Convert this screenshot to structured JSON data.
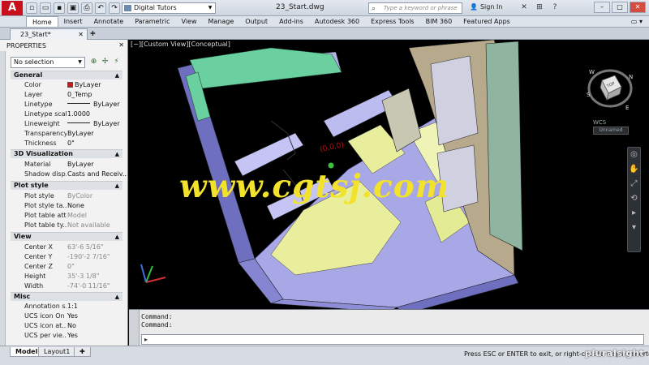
{
  "titlebar": {
    "logo": "A",
    "workspace": "Digital Tutors",
    "doc_title": "23_Start.dwg",
    "search_placeholder": "Type a keyword or phrase",
    "signin": "Sign In"
  },
  "ribbon": {
    "tabs": [
      "Home",
      "Insert",
      "Annotate",
      "Parametric",
      "View",
      "Manage",
      "Output",
      "Add-ins",
      "Autodesk 360",
      "Express Tools",
      "BIM 360",
      "Featured Apps"
    ],
    "active": "Home"
  },
  "file_tab": {
    "label": "23_Start*"
  },
  "properties": {
    "title": "PROPERTIES",
    "selection": "No selection",
    "sections": {
      "general": {
        "title": "General",
        "rows": [
          {
            "k": "Color",
            "v": "ByLayer"
          },
          {
            "k": "Layer",
            "v": "0_Temp"
          },
          {
            "k": "Linetype",
            "v": "ByLayer"
          },
          {
            "k": "Linetype scale",
            "v": "1.0000"
          },
          {
            "k": "Lineweight",
            "v": "ByLayer"
          },
          {
            "k": "Transparency",
            "v": "ByLayer"
          },
          {
            "k": "Thickness",
            "v": "0\""
          }
        ]
      },
      "viz": {
        "title": "3D Visualization",
        "rows": [
          {
            "k": "Material",
            "v": "ByLayer"
          },
          {
            "k": "Shadow disp...",
            "v": "Casts and Receiv..."
          }
        ]
      },
      "plot": {
        "title": "Plot style",
        "rows": [
          {
            "k": "Plot style",
            "v": "ByColor"
          },
          {
            "k": "Plot style ta...",
            "v": "None"
          },
          {
            "k": "Plot table att...",
            "v": "Model"
          },
          {
            "k": "Plot table ty...",
            "v": "Not available"
          }
        ]
      },
      "view": {
        "title": "View",
        "rows": [
          {
            "k": "Center X",
            "v": "63'-6 5/16\""
          },
          {
            "k": "Center Y",
            "v": "-190'-2 7/16\""
          },
          {
            "k": "Center Z",
            "v": "0\""
          },
          {
            "k": "Height",
            "v": "35'-3 1/8\""
          },
          {
            "k": "Width",
            "v": "-74'-0 11/16\""
          }
        ]
      },
      "misc": {
        "title": "Misc",
        "rows": [
          {
            "k": "Annotation s...",
            "v": "1:1"
          },
          {
            "k": "UCS icon On",
            "v": "Yes"
          },
          {
            "k": "UCS icon at...",
            "v": "No"
          },
          {
            "k": "UCS per vie...",
            "v": "Yes"
          }
        ]
      }
    }
  },
  "viewport": {
    "label": "[−][Custom View][Conceptual]",
    "watermark": "www.cgtsj.com",
    "coord_label": "(0,0,0)",
    "wcs": "WCS",
    "unsaved": "Unnamed",
    "compass": {
      "n": "N",
      "e": "E",
      "s": "S",
      "w": "W"
    },
    "viewcube_face": "TOP"
  },
  "command": {
    "line1": "Command:",
    "line2": "Command:"
  },
  "status": {
    "tabs": [
      "Model",
      "Layout1"
    ],
    "message": "Press ESC or ENTER to exit, or right-click to display shortcut menu.",
    "brand": "pluralsight"
  },
  "colors": {
    "wall": "#a9a8e6",
    "wall_dark": "#6e6fbf",
    "floor": "#e9ee9d",
    "roof_green": "#6ad0a0",
    "wood": "#b7a98c",
    "watermark": "#f2e22c"
  }
}
